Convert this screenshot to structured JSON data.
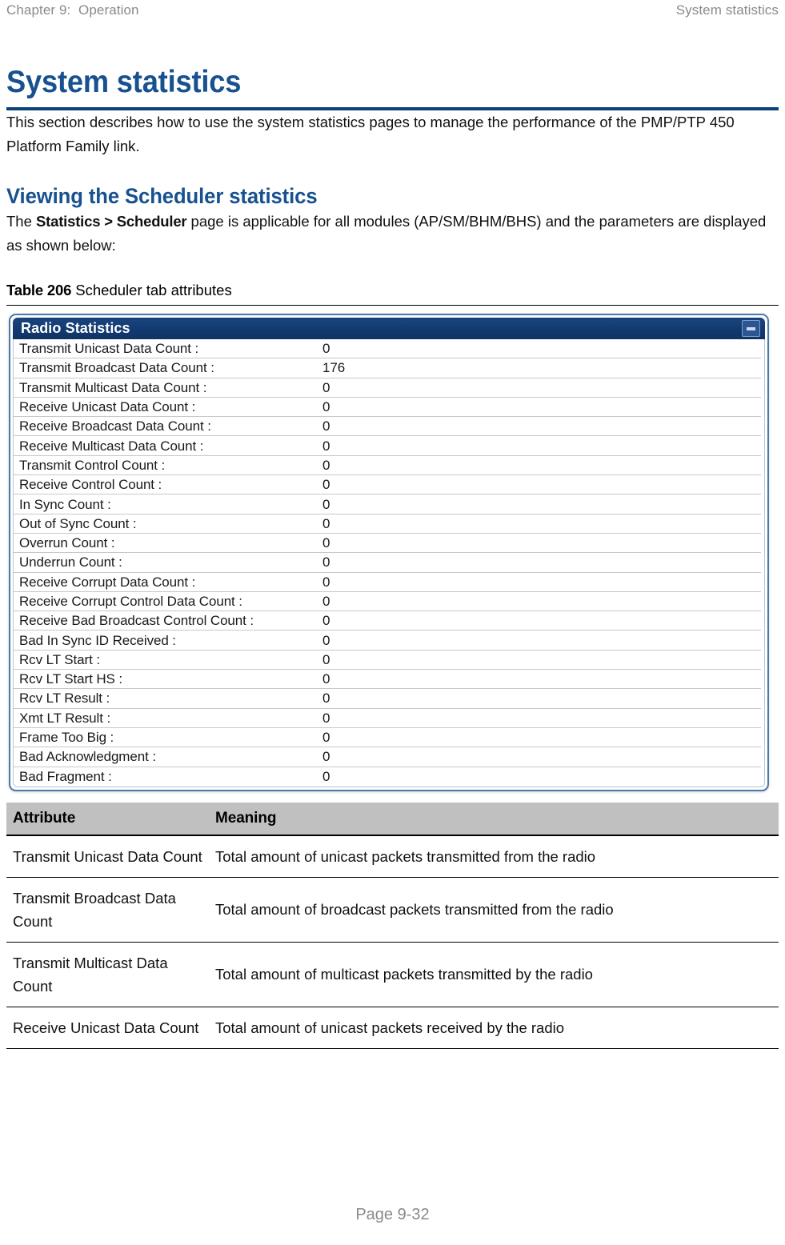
{
  "header": {
    "left": "Chapter 9:  Operation",
    "right": "System statistics"
  },
  "page_title": "System statistics",
  "intro_paragraph": "This section describes how to use the system statistics pages to manage the performance of the PMP/PTP 450 Platform Family link.",
  "section": {
    "heading": "Viewing the Scheduler statistics",
    "para_before": "The ",
    "para_bold": "Statistics > Scheduler",
    "para_after": " page is applicable for all modules (AP/SM/BHM/BHS) and the parameters are displayed as shown below:"
  },
  "table_caption": {
    "label": "Table 206",
    "text": " Scheduler tab attributes"
  },
  "screenshot": {
    "panel_title": "Radio Statistics",
    "minimize_icon": "minimize-icon",
    "rows": [
      {
        "label": "Transmit Unicast Data Count :",
        "value": "0"
      },
      {
        "label": "Transmit Broadcast Data Count :",
        "value": "176"
      },
      {
        "label": "Transmit Multicast Data Count :",
        "value": "0"
      },
      {
        "label": "Receive Unicast Data Count :",
        "value": "0"
      },
      {
        "label": "Receive Broadcast Data Count :",
        "value": "0"
      },
      {
        "label": "Receive Multicast Data Count :",
        "value": "0"
      },
      {
        "label": "Transmit Control Count :",
        "value": "0"
      },
      {
        "label": "Receive Control Count :",
        "value": "0"
      },
      {
        "label": "In Sync Count :",
        "value": "0"
      },
      {
        "label": "Out of Sync Count :",
        "value": "0"
      },
      {
        "label": "Overrun Count :",
        "value": "0"
      },
      {
        "label": "Underrun Count :",
        "value": "0"
      },
      {
        "label": "Receive Corrupt Data Count :",
        "value": "0"
      },
      {
        "label": "Receive Corrupt Control Data Count :",
        "value": "0"
      },
      {
        "label": "Receive Bad Broadcast Control Count :",
        "value": "0"
      },
      {
        "label": "Bad In Sync ID Received :",
        "value": "0"
      },
      {
        "label": "Rcv LT Start :",
        "value": "0"
      },
      {
        "label": "Rcv LT Start HS :",
        "value": "0"
      },
      {
        "label": "Rcv LT Result :",
        "value": "0"
      },
      {
        "label": "Xmt LT Result :",
        "value": "0"
      },
      {
        "label": "Frame Too Big :",
        "value": "0"
      },
      {
        "label": "Bad Acknowledgment :",
        "value": "0"
      },
      {
        "label": "Bad Fragment :",
        "value": "0"
      }
    ]
  },
  "attr_table": {
    "columns": [
      "Attribute",
      "Meaning"
    ],
    "rows": [
      {
        "attribute": "Transmit Unicast Data Count",
        "meaning": "Total amount of unicast packets transmitted from the radio"
      },
      {
        "attribute": "Transmit Broadcast Data Count",
        "meaning": "Total amount of broadcast packets transmitted from the radio"
      },
      {
        "attribute": "Transmit Multicast Data Count",
        "meaning": "Total amount of multicast packets transmitted by the radio"
      },
      {
        "attribute": "Receive Unicast Data Count",
        "meaning": "Total amount of unicast packets received by the radio"
      }
    ]
  },
  "footer": "Page 9-32",
  "colors": {
    "heading_blue": "#17518f",
    "rule_blue": "#0a4178",
    "panel_header_blue": "#123a70",
    "table_header_grey": "#c0c0c0",
    "muted_grey": "#8a8a8a"
  }
}
